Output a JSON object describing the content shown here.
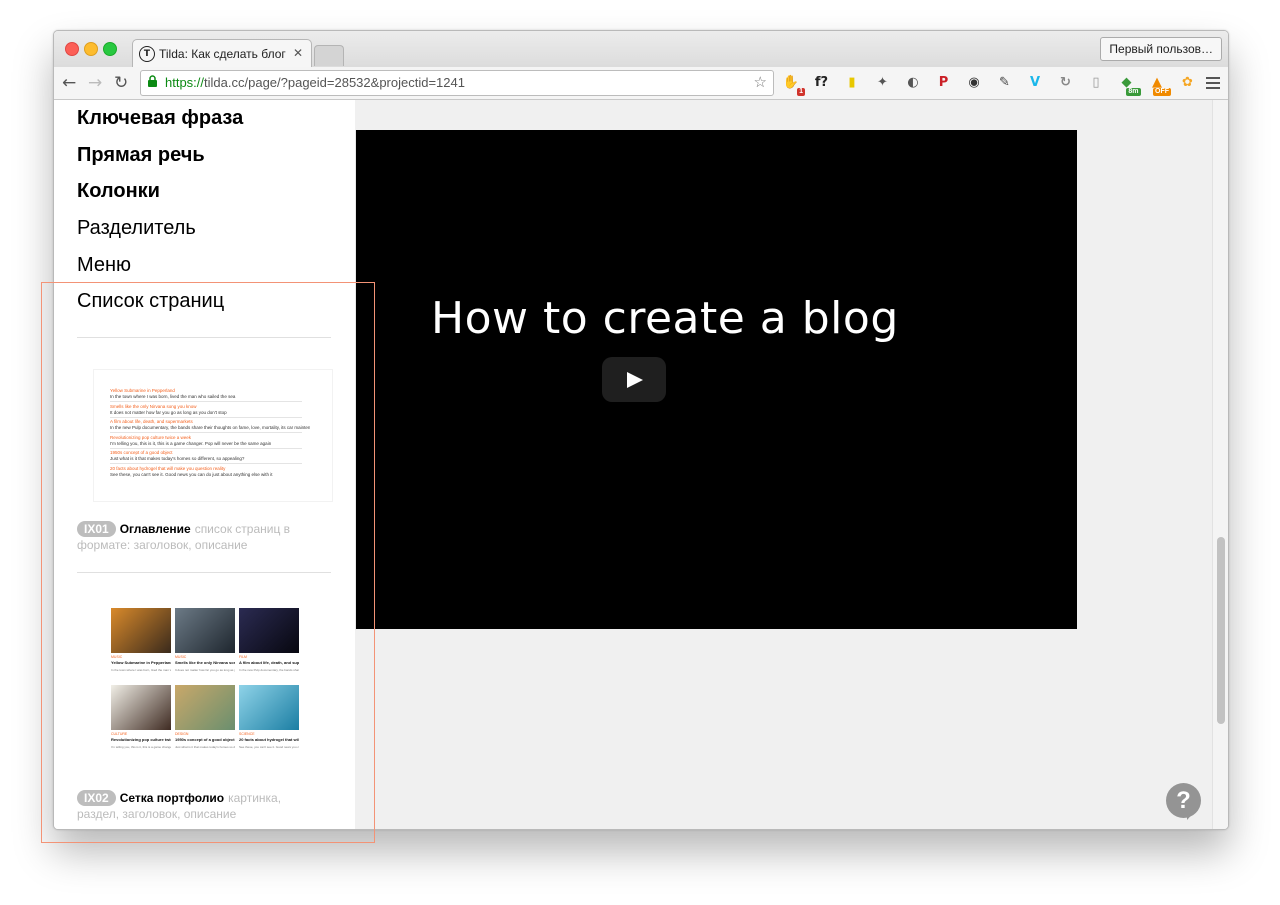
{
  "browser": {
    "tab_title": "Tilda: Как сделать блог",
    "tab_favicon_letter": "T",
    "profile_label": "Первый пользов…",
    "url_scheme": "https://",
    "url_rest": "tilda.cc/page/?pageid=28532&projectid=1241",
    "extensions": [
      {
        "name": "adblock-extension-icon",
        "glyph": "✋",
        "badge": "1",
        "color": "#d0342c"
      },
      {
        "name": "font-finder-extension-icon",
        "glyph": "f?",
        "color": "#222222"
      },
      {
        "name": "flag-extension-icon",
        "glyph": "▮",
        "color": "#e8c800"
      },
      {
        "name": "evernote-extension-icon",
        "glyph": "✦",
        "color": "#555555"
      },
      {
        "name": "pocket-extension-icon",
        "glyph": "◐",
        "color": "#555555"
      },
      {
        "name": "pinterest-extension-icon",
        "glyph": "P",
        "color": "#cb2027"
      },
      {
        "name": "camera-extension-icon",
        "glyph": "◉",
        "color": "#333333"
      },
      {
        "name": "eyedropper-extension-icon",
        "glyph": "✎",
        "color": "#444444"
      },
      {
        "name": "vimeo-extension-icon",
        "glyph": "V",
        "color": "#1ab7ea"
      },
      {
        "name": "refresh-extension-icon",
        "glyph": "↻",
        "color": "#888888"
      },
      {
        "name": "reader-extension-icon",
        "glyph": "▯",
        "color": "#999999"
      },
      {
        "name": "timer-extension-icon",
        "glyph": "◆",
        "badge": "8m",
        "color": "#3a9a3a"
      },
      {
        "name": "stats-extension-icon",
        "glyph": "▲",
        "badge": "OFF",
        "color": "#f08a00"
      },
      {
        "name": "flower-extension-icon",
        "glyph": "✿",
        "color": "#f5a623"
      }
    ]
  },
  "sidebar": {
    "menu_items": [
      {
        "label": "Ключевая фраза"
      },
      {
        "label": "Прямая речь"
      },
      {
        "label": "Колонки"
      },
      {
        "label": "Разделитель"
      },
      {
        "label": "Меню"
      },
      {
        "label": "Список страниц"
      }
    ],
    "blocks": [
      {
        "code": "IX01",
        "name": "Оглавление",
        "description": "список страниц в формате: заголовок, описание"
      },
      {
        "code": "IX02",
        "name": "Сетка портфолио",
        "description": "картинка, раздел, заголовок, описание"
      }
    ],
    "toc_preview": [
      {
        "title": "Yellow Submarine in Pepperland",
        "desc": "In the town where I was born, lived the man who sailed the sea"
      },
      {
        "title": "Smells like the only Nirvana song you know",
        "desc": "It does not matter how far you go as long as you don't stop"
      },
      {
        "title": "A film about life, death, and supermarkets",
        "desc": "In the new Pulp documentary, the bands share their thoughts on fame, love, mortality, its car maintenance"
      },
      {
        "title": "Revolutionizing pop culture twice a week",
        "desc": "I'm telling you, this is it, this is a game changer. Pop will never be the same again"
      },
      {
        "title": "1950s concept of a good object",
        "desc": "Just what is it that makes today's homes so different, so appealing?"
      },
      {
        "title": "20 facts about hydrogel that will make you question reality",
        "desc": "See these, you can't see it. Good news you can do just about anything else with it"
      }
    ],
    "portfolio_preview": [
      {
        "section": "MUSIC",
        "title": "Yellow Submarine in Pepperland",
        "desc": "In the town where I was born, lived the man who sailed the sea",
        "color1": "#d98a2b",
        "color2": "#3a2a1c"
      },
      {
        "section": "MUSIC",
        "title": "Smells like the only Nirvana song you know",
        "desc": "It does not matter how far you go as long as you don't stop",
        "color1": "#6c7a86",
        "color2": "#1e262e"
      },
      {
        "section": "FILM",
        "title": "A film about life, death, and supermarkets",
        "desc": "In the new Pulp documentary, the bands share their thoughts",
        "color1": "#2b2b52",
        "color2": "#07070f"
      },
      {
        "section": "CULTURE",
        "title": "Revolutionizing pop culture twice a week",
        "desc": "I'm telling you, this is it, this is a game changer",
        "color1": "#f1efe7",
        "color2": "#3f2b22"
      },
      {
        "section": "DESIGN",
        "title": "1950s concept of a good object",
        "desc": "Just what is it that makes today's homes so different",
        "color1": "#c9a86a",
        "color2": "#6a8f6e"
      },
      {
        "section": "SCIENCE",
        "title": "20 facts about hydrogel that will make you question reality",
        "desc": "See these, you can't see it. Good news you can do",
        "color1": "#8fd3e8",
        "color2": "#1b7ea3"
      }
    ]
  },
  "video": {
    "title": "How to create a blog"
  },
  "help": {
    "label": "?"
  },
  "colors": {
    "accent_orange": "#f4611e",
    "highlight_border": "#f39376",
    "badge_gray": "#bdbdbd"
  }
}
